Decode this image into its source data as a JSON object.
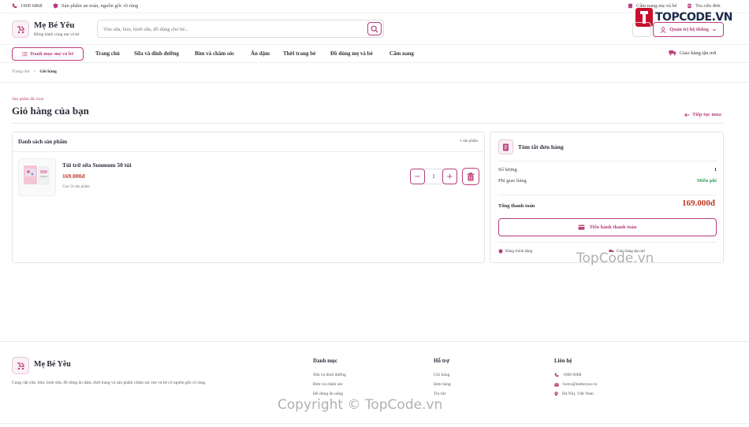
{
  "topbar": {
    "phone": "1900 6868",
    "promise": "Sản phẩm an toàn, nguồn gốc rõ ràng",
    "guide": "Cẩm nang mẹ và bé",
    "track": "Tra cứu đơn"
  },
  "header": {
    "brand": "Mẹ Bé Yêu",
    "tagline": "Đồng hành cùng mẹ và bé",
    "search_placeholder": "Tìm sữa, bỉm, bình sữa, đồ dùng cho bé...",
    "admin_label": "Quản trị hệ thống"
  },
  "nav": {
    "category_button": "Danh mục mẹ và bé",
    "links": [
      "Trang chủ",
      "Sữa và dinh dưỡng",
      "Bỉm và chăm sóc",
      "Ăn dặm",
      "Thời trang bé",
      "Đồ dùng mẹ và bé",
      "Cẩm nang"
    ],
    "shipping": "Giao hàng tận nơi"
  },
  "breadcrumb": {
    "home": "Trang chủ",
    "separator": ">",
    "current": "Giỏ hàng"
  },
  "page": {
    "eyebrow": "Sản phẩm đã chọn",
    "title": "Giỏ hàng của bạn",
    "continue": "Tiếp tục mua"
  },
  "cart": {
    "title": "Danh sách sản phẩm",
    "count_label": "1 sản phẩm",
    "items": [
      {
        "name": "Túi trữ sữa Sunmum 50 túi",
        "price": "169.000đ",
        "stock": "Còn 54 sản phẩm",
        "quantity": "1",
        "minus": "−",
        "plus": "+"
      }
    ]
  },
  "summary": {
    "title": "Tóm tắt đơn hàng",
    "qty_label": "Số lượng",
    "qty_value": "1",
    "ship_label": "Phí giao hàng",
    "ship_value": "Miễn phí",
    "total_label": "Tổng thanh toán",
    "total_value": "169.000đ",
    "checkout_label": "Tiến hành thanh toán",
    "badge_genuine": "Hàng chính hãng",
    "badge_delivery": "Giao hàng tận nơi"
  },
  "watermark": {
    "logo_text": "TOPCODE.VN",
    "middle": "TopCode.vn",
    "bottom": "Copyright © TopCode.vn"
  },
  "footer": {
    "brand": "Mẹ Bé Yêu",
    "description": "Cung cấp sữa, bỉm, bình sữa, đồ dùng ăn dặm, thời trang và sản phẩm chăm sóc mẹ và bé có nguồn gốc rõ ràng.",
    "categories_title": "Danh mục",
    "categories": [
      "Sữa và dinh dưỡng",
      "Bỉm và chăm sóc",
      "Đồ dùng ăn uống"
    ],
    "support_title": "Hỗ trợ",
    "support": [
      "Giỏ hàng",
      "Đơn hàng",
      "Tin tức"
    ],
    "contact_title": "Liên hệ",
    "contact_phone": "1900 6868",
    "contact_email": "hotro@mebeyeu.vn",
    "contact_address": "Hà Nội, Việt Nam"
  },
  "colors": {
    "accent": "#b83d7a",
    "price": "#c0392b",
    "free_shipping": "#2e9e5b"
  }
}
